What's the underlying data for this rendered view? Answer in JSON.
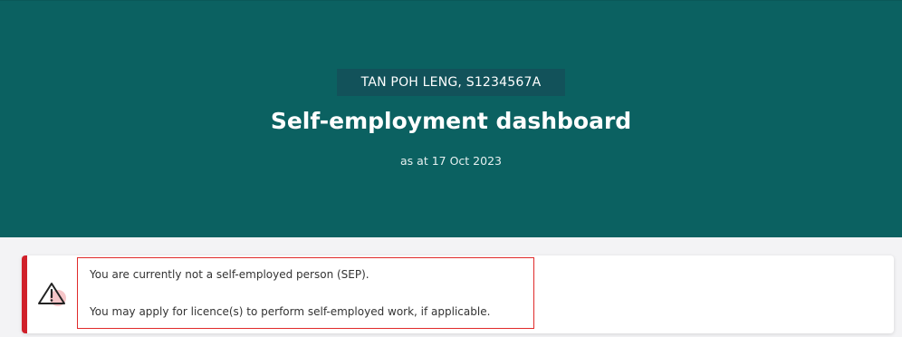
{
  "header": {
    "user_label": "TAN POH LENG, S1234567A",
    "title": "Self-employment dashboard",
    "date_text": "as at 17 Oct 2023"
  },
  "alert": {
    "icon": "warning-triangle-icon",
    "line1": "You are currently not a self-employed person (SEP).",
    "line2": "You may apply for licence(s) to perform self-employed work, if applicable."
  },
  "colors": {
    "hero_background": "#0b6161",
    "name_pill_background": "#12525a",
    "alert_accent": "#d0202a",
    "highlight_border": "#e02a2a"
  }
}
